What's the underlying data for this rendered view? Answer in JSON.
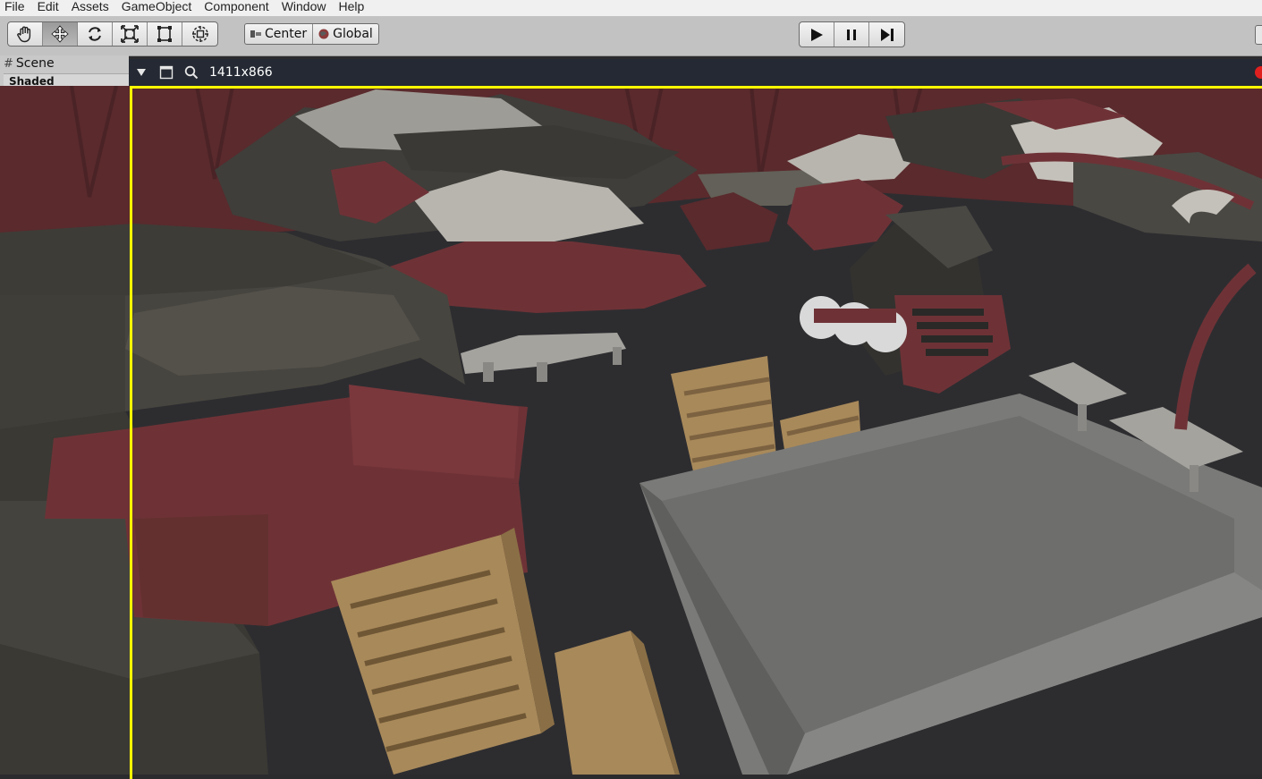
{
  "menu": {
    "items": [
      "File",
      "Edit",
      "Assets",
      "GameObject",
      "Component",
      "Window",
      "Help"
    ]
  },
  "toolbar": {
    "tools": [
      {
        "name": "hand-tool",
        "icon": "hand-icon",
        "active": false
      },
      {
        "name": "move-tool",
        "icon": "move-arrows-icon",
        "active": true
      },
      {
        "name": "rotate-tool",
        "icon": "rotate-icon",
        "active": false
      },
      {
        "name": "scale-tool",
        "icon": "scale-icon",
        "active": false
      },
      {
        "name": "rect-tool",
        "icon": "rect-transform-icon",
        "active": false
      },
      {
        "name": "transform-tool",
        "icon": "transform-icon",
        "active": false
      }
    ],
    "pivot_mode": "Center",
    "pivot_rotation": "Global"
  },
  "scene_panel": {
    "tab_label": "Scene",
    "draw_mode": "Shaded"
  },
  "game_view": {
    "resolution": "1411x866",
    "frame_color": "#ffff00",
    "record_color": "#e01f1f"
  },
  "colors": {
    "toolbar_bg": "#c2c2c2",
    "gamebar_bg": "#242933",
    "floor": "#2b2b2e",
    "rock_dark": "#4a4843",
    "rock_red": "#6e3236",
    "crate": "#a8895a",
    "platform": "#7a7a78"
  }
}
